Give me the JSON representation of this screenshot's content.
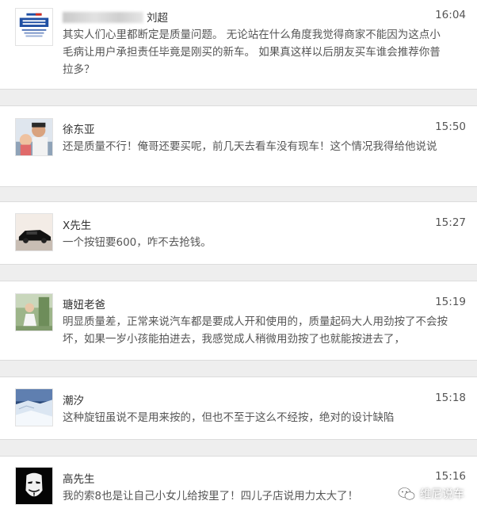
{
  "comments": [
    {
      "name": "刘超",
      "name_blurred": true,
      "avatar": "jaguar-logo",
      "time": "16:04",
      "text": "其实人们心里都断定是质量问题。 无论站在什么角度我觉得商家不能因为这点小毛病让用户承担责任毕竟是刚买的新车。 如果真这样以后朋友买车谁会推荐你普拉多？"
    },
    {
      "name": "徐东亚",
      "avatar": "man-and-child-photo",
      "time": "15:50",
      "text": "还是质量不行！俺哥还要买呢，前几天去看车没有现车！这个情况我得给他说说"
    },
    {
      "name": "X先生",
      "avatar": "black-car-photo",
      "time": "15:27",
      "text": "一个按钮要600，咋不去抢钱。"
    },
    {
      "name": "瑭妞老爸",
      "avatar": "child-outdoor-photo",
      "time": "15:19",
      "text": "明显质量差，正常来说汽车都是要成人开和使用的，质量起码大人用劲按了不会按坏，如果一岁小孩能拍进去，我感觉成人稍微用劲按了也就能按进去了，"
    },
    {
      "name": "潮汐",
      "avatar": "snowy-landscape-photo",
      "time": "15:18",
      "text": "这种旋钮虽说不是用来按的，但也不至于这么不经按，绝对的设计缺陷"
    },
    {
      "name": "高先生",
      "avatar": "guy-fawkes-mask",
      "time": "15:16",
      "text": "我的索8也是让自己小女儿给按里了！四儿子店说用力太大了！"
    }
  ],
  "watermark": {
    "text": "维尼说车",
    "icon": "wechat-icon"
  }
}
